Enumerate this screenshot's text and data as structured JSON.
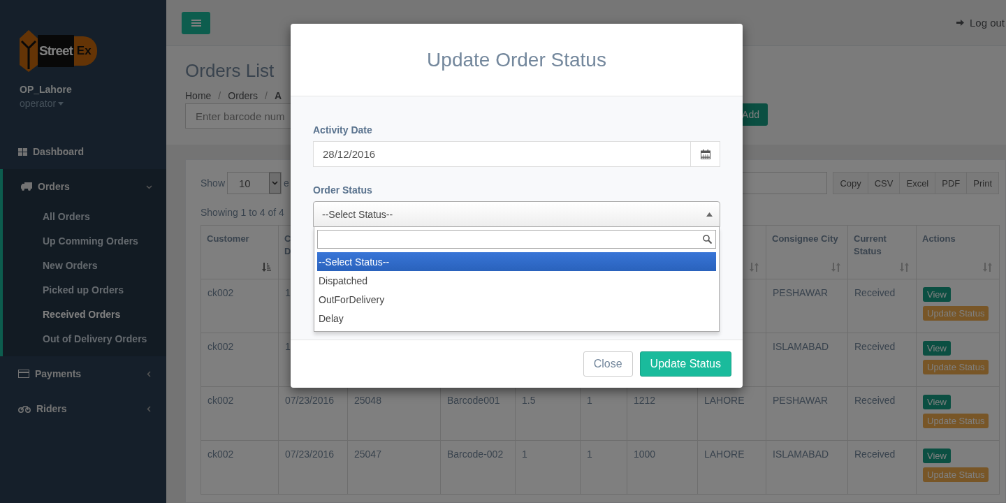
{
  "sidebar": {
    "logo": {
      "text": "Street",
      "accent": "Ex"
    },
    "user": {
      "name": "OP_Lahore",
      "role": "operator"
    },
    "menu": [
      {
        "label": "Dashboard",
        "expanded": false
      },
      {
        "label": "Orders",
        "expanded": true,
        "children": [
          {
            "label": "All Orders",
            "selected": false
          },
          {
            "label": "Up Comming Orders",
            "selected": false
          },
          {
            "label": "New Orders",
            "selected": false
          },
          {
            "label": "Picked up Orders",
            "selected": false
          },
          {
            "label": "Received Orders",
            "selected": true
          },
          {
            "label": "Out of Delivery Orders",
            "selected": false
          }
        ]
      },
      {
        "label": "Payments",
        "expanded": false
      },
      {
        "label": "Riders",
        "expanded": false
      }
    ]
  },
  "top_nav": {
    "logout": "Log out"
  },
  "page": {
    "title": "Orders List",
    "breadcrumb": [
      "Home",
      "Orders",
      "A"
    ],
    "breadcrumb_separator": "/",
    "barcode_field": {
      "placeholder": "Enter barcode num"
    },
    "add_button": "Add"
  },
  "panel": {
    "show_label": "Show",
    "page_size": "10",
    "entries_label": "e",
    "export_buttons": [
      "Copy",
      "CSV",
      "Excel",
      "PDF",
      "Print"
    ],
    "info": "Showing 1 to 4 of 4"
  },
  "table": {
    "columns": [
      {
        "label": "Customer",
        "sorted": true
      },
      {
        "label": "C\nD"
      },
      {},
      {},
      {},
      {},
      {},
      {
        "sorted": false
      },
      {
        "label": "Consignee City",
        "sorted": false
      },
      {
        "label": "Current Status",
        "sorted": false
      },
      {
        "label": "Actions",
        "sorted": false
      }
    ],
    "rows": [
      {
        "cells": [
          "ck002",
          "1",
          null,
          null,
          null,
          null,
          null,
          null,
          "PESHAWAR",
          "Received"
        ],
        "actions": [
          "View",
          "Update Status"
        ]
      },
      {
        "cells": [
          "ck002",
          "1",
          null,
          null,
          null,
          null,
          null,
          null,
          "ISLAMABAD",
          "Received"
        ],
        "actions": [
          "View",
          "Update Status"
        ]
      },
      {
        "cells": [
          "ck002",
          "07/23/2016",
          "25048",
          "Barcode001",
          "1.5",
          "1",
          "1212",
          "LAHORE",
          "PESHAWAR",
          "Received"
        ],
        "actions": [
          "View",
          "Update Status"
        ]
      },
      {
        "cells": [
          "ck002",
          "07/23/2016",
          "25047",
          "Barcode-002",
          "1",
          "1",
          "1000",
          "LAHORE",
          "ISLAMABAD",
          "Received"
        ],
        "actions": [
          "View",
          "Update Status"
        ]
      }
    ]
  },
  "modal": {
    "title": "Update Order Status",
    "date_label": "Activity Date",
    "date_value": "28/12/2016",
    "status_label": "Order Status",
    "status_value": "--Select Status--",
    "dropdown_open": true,
    "options": [
      {
        "label": "--Select Status--",
        "selected": true
      },
      {
        "label": "Dispatched",
        "selected": false
      },
      {
        "label": "OutForDelivery",
        "selected": false
      },
      {
        "label": "Delay",
        "selected": false
      }
    ],
    "buttons": [
      {
        "label": "Close",
        "kind": "default"
      },
      {
        "label": "Update Status",
        "kind": "primary"
      }
    ]
  }
}
